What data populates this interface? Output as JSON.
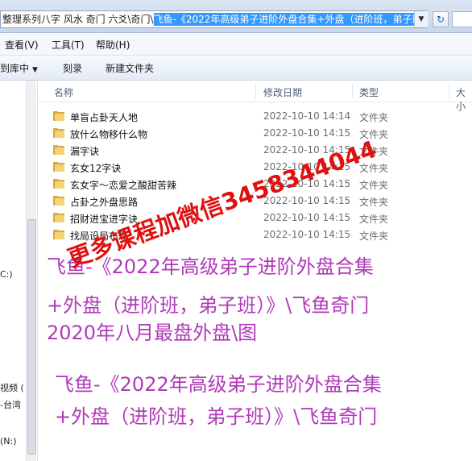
{
  "address": {
    "plain_text": "整理系列八字 风水 奇门 六爻\\奇门\\",
    "selected_text": "飞鱼-《2022年高级弟子进阶外盘合集+外盘（进阶班，弟子班"
  },
  "menu": [
    "查看(V)",
    "工具(T)",
    "帮助(H)"
  ],
  "toolbar": {
    "include_label": "到库中",
    "burn_label": "刻录",
    "new_folder_label": "新建文件夹"
  },
  "columns": {
    "name": "名称",
    "date": "修改日期",
    "type": "类型",
    "size": "大小"
  },
  "files": [
    {
      "name": "单盲占卦天人地",
      "date": "2022-10-10 14:14",
      "type": "文件夹"
    },
    {
      "name": "放什么物移什么物",
      "date": "2022-10-10 14:15",
      "type": "文件夹"
    },
    {
      "name": "漏字诀",
      "date": "2022-10-10 14:15",
      "type": "文件夹"
    },
    {
      "name": "玄女12字诀",
      "date": "2022-10-10 14:15",
      "type": "文件夹"
    },
    {
      "name": "玄女字～恋爱之酸甜苦辣",
      "date": "2022-10-10 14:15",
      "type": "文件夹"
    },
    {
      "name": "占卦之外盘思路",
      "date": "2022-10-10 14:15",
      "type": "文件夹"
    },
    {
      "name": "招财进宝进字诀",
      "date": "2022-10-10 14:15",
      "type": "文件夹"
    },
    {
      "name": "找局设局布局",
      "date": "2022-10-10 14:15",
      "type": "文件夹"
    }
  ],
  "nav": [
    "C:)",
    "视频 (",
    "-台湾",
    "(N:)"
  ],
  "watermark": "更多课程加微信3458344044",
  "captions": [
    "飞鱼-《2022年高级弟子进阶外盘合集",
    "+外盘（进阶班，弟子班）》\\飞鱼奇门",
    "2020年八月最盘外盘\\图",
    "飞鱼-《2022年高级弟子进阶外盘合集",
    "+外盘（进阶班，弟子班）》\\飞鱼奇门"
  ],
  "colors": {
    "accent": "#3399ff",
    "watermark": "#e01010",
    "caption": "#b03ab8",
    "folder": "#f5d374"
  }
}
